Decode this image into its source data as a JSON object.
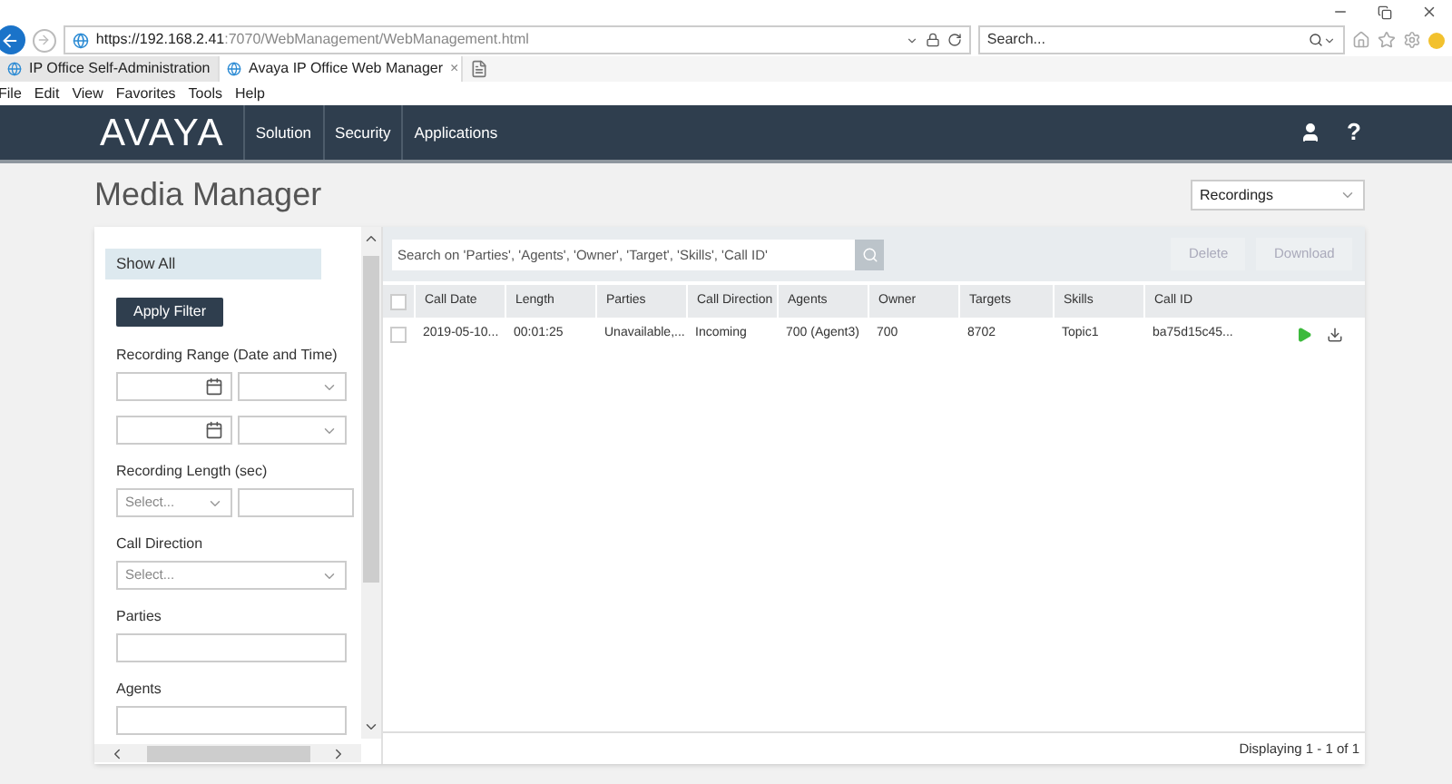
{
  "browser": {
    "url_host": "https://192.168.2.41",
    "url_path": ":7070/WebManagement/WebManagement.html",
    "search": {
      "placeholder": "Search..."
    },
    "tabs": [
      {
        "label": "IP Office Self-Administration",
        "selected": false
      },
      {
        "label": "Avaya IP Office Web Manager",
        "selected": true,
        "close": "×"
      }
    ],
    "menu": [
      "File",
      "Edit",
      "View",
      "Favorites",
      "Tools",
      "Help"
    ]
  },
  "nav": {
    "logo": "AVAYA",
    "items": [
      "Solution",
      "Security",
      "Applications"
    ],
    "help": "?"
  },
  "page": {
    "title": "Media Manager",
    "view_select": "Recordings"
  },
  "filter": {
    "show_all": {
      "label": "Show All",
      "selected": true
    },
    "apply": "Apply Filter",
    "recording_range": "Recording Range (Date and Time)",
    "recording_length": {
      "label": "Recording Length (sec)",
      "placeholder": "Select..."
    },
    "call_direction": {
      "label": "Call Direction",
      "placeholder": "Select..."
    },
    "parties": "Parties",
    "agents": "Agents"
  },
  "toolbar": {
    "search": {
      "placeholder": "Search on 'Parties', 'Agents', 'Owner', 'Target', 'Skills', 'Call ID'"
    },
    "buttons": [
      {
        "label": "Delete",
        "disabled": true
      },
      {
        "label": "Download",
        "disabled": true
      }
    ]
  },
  "table": {
    "select_all_checked": false,
    "columns": [
      "Call Date",
      "Length",
      "Parties",
      "Call Direction",
      "Agents",
      "Owner",
      "Targets",
      "Skills",
      "Call ID"
    ],
    "rows": [
      {
        "checked": false,
        "cells": [
          "2019-05-10...",
          "00:01:25",
          "Unavailable,...",
          "Incoming",
          "700 (Agent3)",
          "700",
          "8702",
          "Topic1",
          "ba75d15c45..."
        ]
      }
    ]
  },
  "status": "Displaying 1 - 1 of 1"
}
